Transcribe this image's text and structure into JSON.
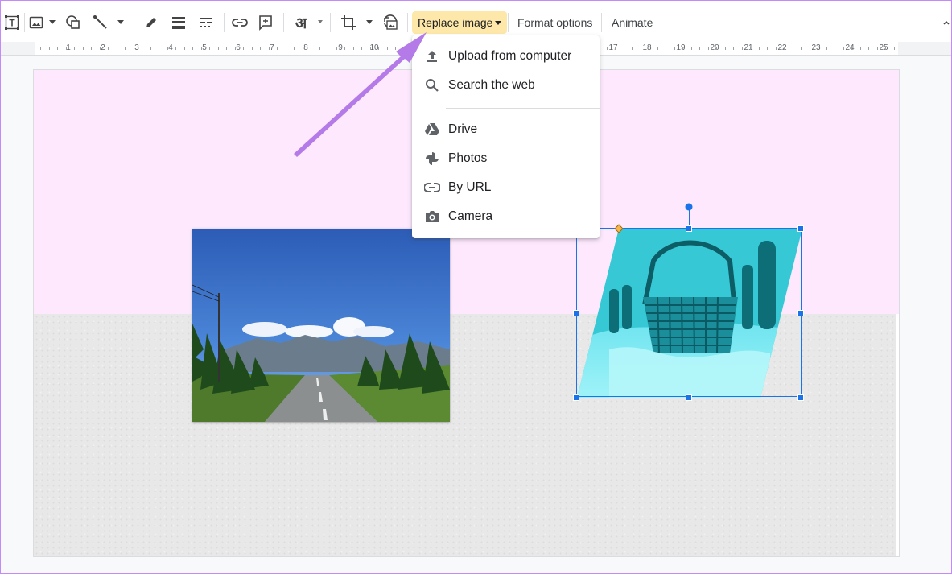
{
  "toolbar": {
    "replace_image_label": "Replace image",
    "format_options_label": "Format options",
    "animate_label": "Animate",
    "input_tools_glyph": "अ"
  },
  "ruler": {
    "numbers": [
      "1",
      "2",
      "3",
      "4",
      "5",
      "6",
      "7",
      "8",
      "9",
      "10",
      "17",
      "18",
      "19",
      "20",
      "21",
      "22",
      "23",
      "24",
      "25"
    ]
  },
  "replace_menu": {
    "items": [
      {
        "label": "Upload from computer",
        "icon": "upload-icon"
      },
      {
        "label": "Search the web",
        "icon": "search-icon"
      },
      {
        "label": "Drive",
        "icon": "drive-icon"
      },
      {
        "label": "Photos",
        "icon": "photos-icon"
      },
      {
        "label": "By URL",
        "icon": "link-icon"
      },
      {
        "label": "Camera",
        "icon": "camera-icon"
      }
    ]
  },
  "colors": {
    "accent": "#1a73e8",
    "active_button_bg": "#fde7a9",
    "slide_top": "#fde8fd",
    "slide_bottom": "#e8e8e8",
    "arrow": "#b37ae8"
  },
  "slide": {
    "images": [
      {
        "name": "road-landscape-photo"
      },
      {
        "name": "basket-cyan-photo"
      }
    ]
  }
}
